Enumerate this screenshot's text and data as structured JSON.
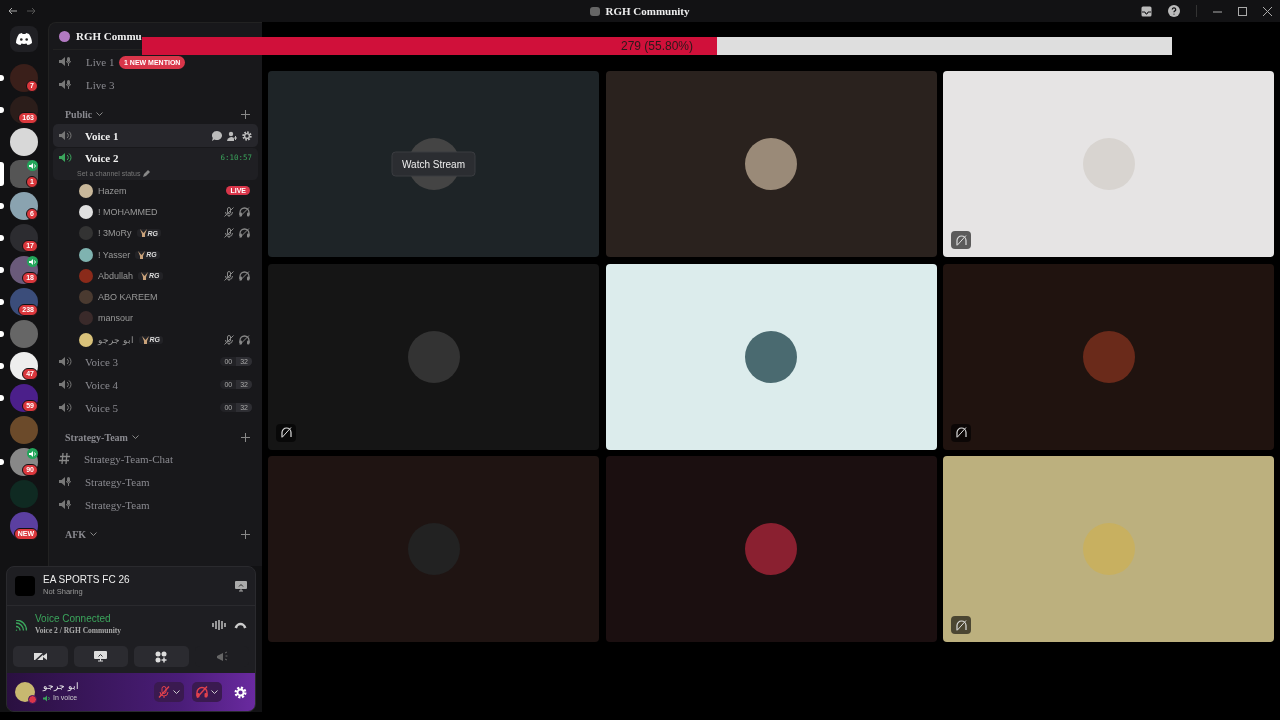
{
  "window": {
    "title": "RGH Community"
  },
  "progress": {
    "label": "279 (55.80%)",
    "level": 0.558
  },
  "servers": [
    {
      "badge": "7",
      "unread": true,
      "in_voice": false,
      "selected": false
    },
    {
      "badge": "163",
      "unread": true,
      "in_voice": false,
      "selected": false
    },
    {
      "unread": false,
      "in_voice": false,
      "selected": false
    },
    {
      "badge": "1",
      "unread": false,
      "in_voice": true,
      "selected": true
    },
    {
      "badge": "6",
      "unread": true,
      "in_voice": false,
      "selected": false
    },
    {
      "badge": "17",
      "unread": true,
      "in_voice": false,
      "selected": false
    },
    {
      "badge": "18",
      "unread": true,
      "in_voice": true,
      "selected": false
    },
    {
      "badge": "238",
      "unread": true,
      "in_voice": false,
      "selected": false
    },
    {
      "unread": true,
      "in_voice": false,
      "selected": false
    },
    {
      "badge": "47",
      "unread": true,
      "in_voice": false,
      "selected": false
    },
    {
      "badge": "59",
      "unread": true,
      "in_voice": false,
      "selected": false
    },
    {
      "unread": false,
      "in_voice": false,
      "selected": false
    },
    {
      "badge": "90",
      "unread": true,
      "in_voice": true,
      "selected": false
    },
    {
      "unread": false,
      "in_voice": false,
      "selected": false
    },
    {
      "badge": "NEW",
      "unread": false,
      "in_voice": false,
      "selected": false
    }
  ],
  "server_header": {
    "name": "RGH Commu"
  },
  "mention_pill": "1 NEW MENTION",
  "channels": [
    {
      "kind": "stage",
      "name": "Live 1"
    },
    {
      "kind": "stage",
      "name": "Live 3"
    },
    {
      "kind": "category",
      "name": "Public",
      "children": [
        {
          "kind": "voice",
          "name": "Voice 1",
          "selected": true
        },
        {
          "kind": "voice",
          "name": "Voice 2",
          "selected": false,
          "connected": true,
          "timer": "6:10:57",
          "status": "Set a channel status",
          "members": [
            {
              "name": "Hazem",
              "badge": "LIVE",
              "muted": false,
              "deafened": false
            },
            {
              "name": "! MOHAMMED",
              "muted": true,
              "deafened": true
            },
            {
              "name": "! 3MoRy",
              "tag": "RG",
              "muted": true,
              "deafened": true
            },
            {
              "name": "! Yasser",
              "tag": "RG",
              "muted": false,
              "deafened": false
            },
            {
              "name": "Abdullah",
              "tag": "RG",
              "muted": true,
              "deafened": true
            },
            {
              "name": "ABO KAREEM",
              "muted": false,
              "deafened": false
            },
            {
              "name": "mansour",
              "muted": false,
              "deafened": false
            },
            {
              "name": "ابو جرجو",
              "tag": "RG",
              "muted": true,
              "deafened": true
            }
          ]
        },
        {
          "kind": "voice",
          "name": "Voice 3",
          "selected": false,
          "limit": [
            "00",
            "32"
          ]
        },
        {
          "kind": "voice",
          "name": "Voice 4",
          "selected": false,
          "limit": [
            "00",
            "32"
          ]
        },
        {
          "kind": "voice",
          "name": "Voice 5",
          "selected": false,
          "limit": [
            "00",
            "32"
          ]
        }
      ]
    },
    {
      "kind": "category",
      "name": "Strategy-Team",
      "children": [
        {
          "kind": "text",
          "name": "Strategy-Team-Chat",
          "selected": false
        },
        {
          "kind": "stage",
          "name": "Strategy-Team"
        },
        {
          "kind": "stage",
          "name": "Strategy-Team"
        }
      ]
    },
    {
      "kind": "category",
      "name": "AFK"
    }
  ],
  "activity": {
    "title": "EA SPORTS FC 26",
    "subtitle": "Not Sharing"
  },
  "voice": {
    "status": "Voice Connected",
    "channel": "Voice 2 / RGH Community"
  },
  "user": {
    "name": "ابو جرجو",
    "status": "In voice",
    "muted": true,
    "deafened": true
  },
  "tiles": [
    {
      "color": "#1e2427",
      "button": "Watch Stream",
      "camera_off": false
    },
    {
      "color": "#2a221e",
      "camera_off": false
    },
    {
      "color": "#e6e4e4",
      "camera_off": true
    },
    {
      "color": "#151515",
      "camera_off": true
    },
    {
      "color": "#dcecec",
      "camera_off": false
    },
    {
      "color": "#20130f",
      "camera_off": true
    },
    {
      "color": "#1f1412",
      "camera_off": false
    },
    {
      "color": "#1b0f10",
      "camera_off": false
    },
    {
      "color": "#bcb07e",
      "camera_off": true
    }
  ]
}
